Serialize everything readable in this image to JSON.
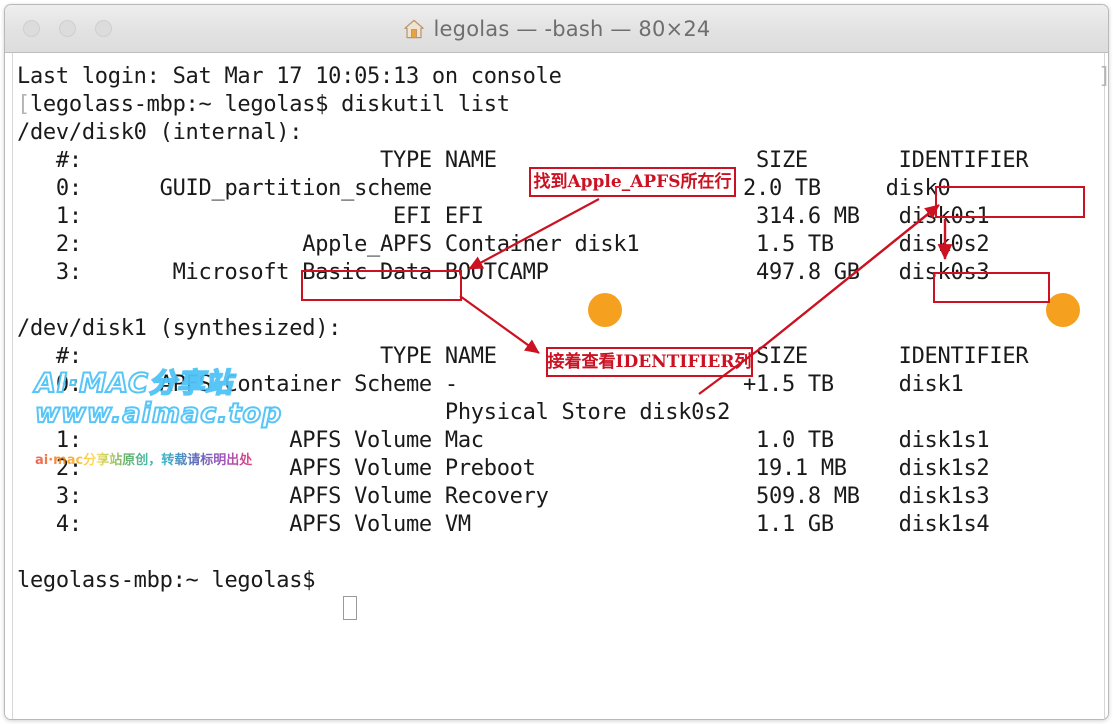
{
  "window": {
    "title": "legolas — -bash — 80×24",
    "home_icon": "home-icon",
    "traffic_lights": [
      "close",
      "minimize",
      "zoom"
    ]
  },
  "terminal": {
    "lines": [
      "Last login: Sat Mar 17 10:05:13 on console",
      "[legolass-mbp:~ legolas$ diskutil list",
      "/dev/disk0 (internal):",
      "   #:                       TYPE NAME                    SIZE       IDENTIFIER",
      "   0:      GUID_partition_scheme                        2.0 TB     disk0",
      "   1:                        EFI EFI                     314.6 MB   disk0s1",
      "   2:                 Apple_APFS Container disk1         1.5 TB     disk0s2",
      "   3:       Microsoft Basic Data BOOTCAMP                497.8 GB   disk0s3",
      "",
      "/dev/disk1 (synthesized):",
      "   #:                       TYPE NAME                    SIZE       IDENTIFIER",
      "   0:      APFS Container Scheme -                      +1.5 TB     disk1",
      "                                 Physical Store disk0s2",
      "   1:                APFS Volume Mac                     1.0 TB     disk1s1",
      "   2:                APFS Volume Preboot                 19.1 MB    disk1s2",
      "   3:                APFS Volume Recovery                509.8 MB   disk1s3",
      "   4:                APFS Volume VM                      1.1 GB     disk1s4",
      "",
      "legolass-mbp:~ legolas$ "
    ],
    "edge_bracket": "]",
    "prompt": "legolass-mbp:~ legolas$",
    "command": "diskutil list"
  },
  "annotations": {
    "color": "#cc1122",
    "box1_text": "找到Apple_APFS所在行",
    "box2_text": "接着查看IDENTIFIER列",
    "highlight_apple_apfs": "Apple_APFS",
    "highlight_identifier": "IDENTIFIER",
    "highlight_disk0s2": "disk0s2",
    "dot_color": "#f5a01e",
    "dots": 2
  },
  "watermark": {
    "line1": "AI·MAC分享站",
    "line2": "www.aimac.top",
    "sub": "ai·mac分享站原创，转载请标明出处"
  }
}
